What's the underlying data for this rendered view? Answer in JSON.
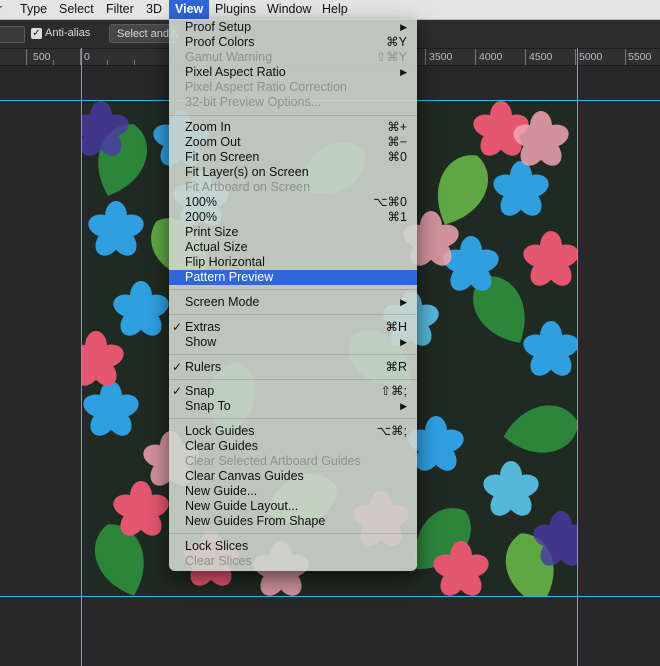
{
  "menubar": {
    "items": [
      {
        "label": "r"
      },
      {
        "label": "Type"
      },
      {
        "label": "Select"
      },
      {
        "label": "Filter"
      },
      {
        "label": "3D"
      },
      {
        "label": "View"
      },
      {
        "label": "Plugins"
      },
      {
        "label": "Window"
      },
      {
        "label": "Help"
      }
    ]
  },
  "options_bar": {
    "anti_alias_label": "Anti-alias",
    "anti_alias_checked": true,
    "select_button_label": "Select and Mask..."
  },
  "ruler": {
    "labels": [
      "500",
      "0",
      "3500",
      "4000",
      "4500",
      "5000",
      "5500"
    ]
  },
  "view_menu": {
    "sections": [
      [
        {
          "label": "Proof Setup",
          "shortcut": "",
          "submenu": true,
          "enabled": true
        },
        {
          "label": "Proof Colors",
          "shortcut": "⌘Y",
          "enabled": true
        },
        {
          "label": "Gamut Warning",
          "shortcut": "⇧⌘Y",
          "enabled": false
        },
        {
          "label": "Pixel Aspect Ratio",
          "shortcut": "",
          "submenu": true,
          "enabled": true
        },
        {
          "label": "Pixel Aspect Ratio Correction",
          "shortcut": "",
          "enabled": false
        },
        {
          "label": "32-bit Preview Options...",
          "shortcut": "",
          "enabled": false
        }
      ],
      [
        {
          "label": "Zoom In",
          "shortcut": "⌘+",
          "enabled": true
        },
        {
          "label": "Zoom Out",
          "shortcut": "⌘−",
          "enabled": true
        },
        {
          "label": "Fit on Screen",
          "shortcut": "⌘0",
          "enabled": true
        },
        {
          "label": "Fit Layer(s) on Screen",
          "shortcut": "",
          "enabled": true
        },
        {
          "label": "Fit Artboard on Screen",
          "shortcut": "",
          "enabled": false
        },
        {
          "label": "100%",
          "shortcut": "⌥⌘0",
          "enabled": true
        },
        {
          "label": "200%",
          "shortcut": "⌘1",
          "enabled": true
        },
        {
          "label": "Print Size",
          "shortcut": "",
          "enabled": true
        },
        {
          "label": "Actual Size",
          "shortcut": "",
          "enabled": true
        },
        {
          "label": "Flip Horizontal",
          "shortcut": "",
          "enabled": true
        },
        {
          "label": "Pattern Preview",
          "shortcut": "",
          "enabled": true,
          "highlighted": true
        }
      ],
      [
        {
          "label": "Screen Mode",
          "shortcut": "",
          "submenu": true,
          "enabled": true
        }
      ],
      [
        {
          "label": "Extras",
          "shortcut": "⌘H",
          "checked": true,
          "enabled": true
        },
        {
          "label": "Show",
          "shortcut": "",
          "submenu": true,
          "enabled": true
        }
      ],
      [
        {
          "label": "Rulers",
          "shortcut": "⌘R",
          "checked": true,
          "enabled": true
        }
      ],
      [
        {
          "label": "Snap",
          "shortcut": "⇧⌘;",
          "checked": true,
          "enabled": true
        },
        {
          "label": "Snap To",
          "shortcut": "",
          "submenu": true,
          "enabled": true
        }
      ],
      [
        {
          "label": "Lock Guides",
          "shortcut": "⌥⌘;",
          "enabled": true
        },
        {
          "label": "Clear Guides",
          "shortcut": "",
          "enabled": true
        },
        {
          "label": "Clear Selected Artboard Guides",
          "shortcut": "",
          "enabled": false
        },
        {
          "label": "Clear Canvas Guides",
          "shortcut": "",
          "enabled": true
        },
        {
          "label": "New Guide...",
          "shortcut": "",
          "enabled": true
        },
        {
          "label": "New Guide Layout...",
          "shortcut": "",
          "enabled": true
        },
        {
          "label": "New Guides From Shape",
          "shortcut": "",
          "enabled": true
        }
      ],
      [
        {
          "label": "Lock Slices",
          "shortcut": "",
          "enabled": true
        },
        {
          "label": "Clear Slices",
          "shortcut": "",
          "enabled": false
        }
      ]
    ]
  },
  "colors": {
    "menu_highlight": "#2f67d6",
    "guide": "#27c6d6",
    "canvas_bg": "#282828"
  }
}
